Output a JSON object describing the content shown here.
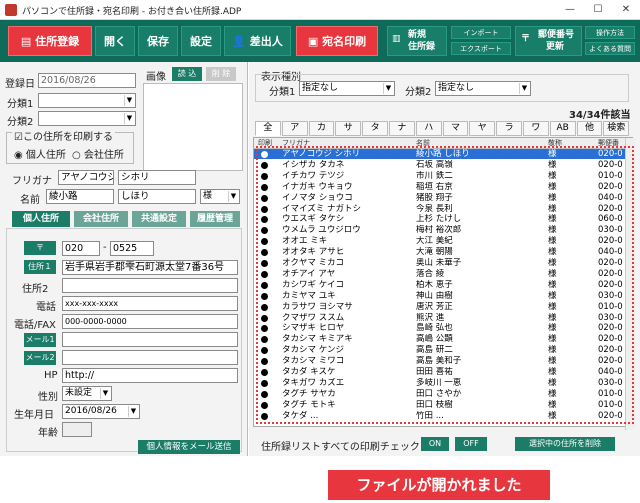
{
  "window": {
    "title": "パソコンで住所録・宛名印刷 - お付き合い住所録.ADP",
    "minimize": "—",
    "maximize": "☐",
    "close": "✕"
  },
  "toolbar": {
    "register": "住所登録",
    "open": "開く",
    "save": "保存",
    "settings": "設定",
    "sender": "差出人",
    "print": "宛名印刷",
    "new_line1": "新規",
    "new_line2": "住所録",
    "import": "インポート",
    "export": "エクスポート",
    "postal_line1": "郵便番号",
    "postal_line2": "更新",
    "manual": "操作方法",
    "faq": "よくある質問"
  },
  "form": {
    "reg_date_label": "登録日",
    "reg_date": "2016/08/26",
    "image_label": "画像",
    "image_load": "読 込",
    "image_delete": "削 除",
    "cat1_label": "分類1",
    "cat2_label": "分類2",
    "print_check": "この住所を印刷する",
    "radio_personal": "個人住所",
    "radio_company": "会社住所",
    "furigana_label": "フリガナ",
    "furi_last": "アヤノコウジ",
    "furi_first": "シホリ",
    "name_label": "名前",
    "name_last": "綾小路",
    "name_first": "しほり",
    "honorific": "様",
    "tab_personal": "個人住所",
    "tab_company": "会社住所",
    "tab_common": "共通設定",
    "tab_history": "履歴管理",
    "zip_label": "〒",
    "zip1": "020",
    "zip_sep": "-",
    "zip2": "0525",
    "addr1_label": "住所１",
    "addr1": "岩手県岩手郡雫石町源太堂7番36号",
    "addr2_label": "住所2",
    "phone_label": "電話",
    "phone": "xxx-xxx-xxxx",
    "fax_label": "電話/FAX",
    "fax": "000-0000-0000",
    "mail1_label": "メール1",
    "mail2_label": "メール2",
    "hp_label": "HP",
    "hp": "http://",
    "gender_label": "性別",
    "gender": "未設定",
    "birth_label": "生年月日",
    "birth": "2016/08/26",
    "age_label": "年齢",
    "send_mail": "個人情報をメール送信"
  },
  "filter": {
    "group_label": "表示種別",
    "cat1_label": "分類1",
    "cat1": "指定なし",
    "cat2_label": "分類2",
    "cat2": "指定なし",
    "count": "34/34件該当"
  },
  "kana_tabs": [
    "全",
    "ア",
    "カ",
    "サ",
    "タ",
    "ナ",
    "ハ",
    "マ",
    "ヤ",
    "ラ",
    "ワ",
    "AB",
    "他",
    "検索"
  ],
  "table": {
    "headers": [
      "印刷",
      "フリガナ",
      "名前",
      "敬称",
      "郵便番"
    ],
    "rows": [
      {
        "furi": "アヤノコウジ シホリ",
        "name": "綾小路 しほり",
        "hon": "様",
        "zip": "020-0"
      },
      {
        "furi": "イシザカ タカネ",
        "name": "石坂 高嶺",
        "hon": "様",
        "zip": "020-0"
      },
      {
        "furi": "イチカワ テツジ",
        "name": "市川 鉄二",
        "hon": "様",
        "zip": "010-0"
      },
      {
        "furi": "イナガキ ウキョウ",
        "name": "稲垣 右京",
        "hon": "様",
        "zip": "020-0"
      },
      {
        "furi": "イノマタ ショウコ",
        "name": "猪股 翔子",
        "hon": "様",
        "zip": "040-0"
      },
      {
        "furi": "イマイズミ ナガトシ",
        "name": "今泉 長利",
        "hon": "様",
        "zip": "020-0"
      },
      {
        "furi": "ウエスギ タケシ",
        "name": "上杉 たけし",
        "hon": "様",
        "zip": "060-0"
      },
      {
        "furi": "ウメムラ ユウジロウ",
        "name": "梅村 裕次郎",
        "hon": "様",
        "zip": "030-0"
      },
      {
        "furi": "オオエ ミキ",
        "name": "大江 美紀",
        "hon": "様",
        "zip": "020-0"
      },
      {
        "furi": "オオタキ アサヒ",
        "name": "大滝 朝陽",
        "hon": "様",
        "zip": "040-0"
      },
      {
        "furi": "オクヤマ ミカコ",
        "name": "奥山 未華子",
        "hon": "様",
        "zip": "020-0"
      },
      {
        "furi": "オチアイ アヤ",
        "name": "落合 綾",
        "hon": "様",
        "zip": "020-0"
      },
      {
        "furi": "カシワギ ケイコ",
        "name": "柏木 恵子",
        "hon": "様",
        "zip": "020-0"
      },
      {
        "furi": "カミヤマ ユキ",
        "name": "神山 由樹",
        "hon": "様",
        "zip": "030-0"
      },
      {
        "furi": "カラサワ ヨシマサ",
        "name": "唐沢 芳正",
        "hon": "様",
        "zip": "010-0"
      },
      {
        "furi": "クマザワ ススム",
        "name": "熊沢 進",
        "hon": "様",
        "zip": "030-0"
      },
      {
        "furi": "シマザキ ヒロヤ",
        "name": "島崎 弘也",
        "hon": "様",
        "zip": "020-0"
      },
      {
        "furi": "タカシマ キミアキ",
        "name": "高嶋 公顕",
        "hon": "様",
        "zip": "020-0"
      },
      {
        "furi": "タカシマ ケンジ",
        "name": "高島 研二",
        "hon": "様",
        "zip": "020-0"
      },
      {
        "furi": "タカシマ ミワコ",
        "name": "高島 美和子",
        "hon": "様",
        "zip": "020-0"
      },
      {
        "furi": "タカダ キスケ",
        "name": "田田 喜祐",
        "hon": "様",
        "zip": "040-0"
      },
      {
        "furi": "タキガワ カズエ",
        "name": "多岐川 一恵",
        "hon": "様",
        "zip": "030-0"
      },
      {
        "furi": "タグチ サヤカ",
        "name": "田口 さやか",
        "hon": "様",
        "zip": "010-0"
      },
      {
        "furi": "タグチ モトキ",
        "name": "田口 枝樹",
        "hon": "様",
        "zip": "010-0"
      },
      {
        "furi": "タケダ ...",
        "name": "竹田 ...",
        "hon": "様",
        "zip": "020-0"
      }
    ]
  },
  "bottom": {
    "check_label": "住所録リストすべての印刷チェック:",
    "on": "ON",
    "off": "OFF",
    "delete": "選択中の住所を削除"
  },
  "message": "ファイルが開かれました",
  "colors": {
    "toolbar": "#0e6b5a",
    "accent_red": "#e8363f",
    "button_green": "#1b7c68",
    "selection": "#2a6fd6"
  }
}
